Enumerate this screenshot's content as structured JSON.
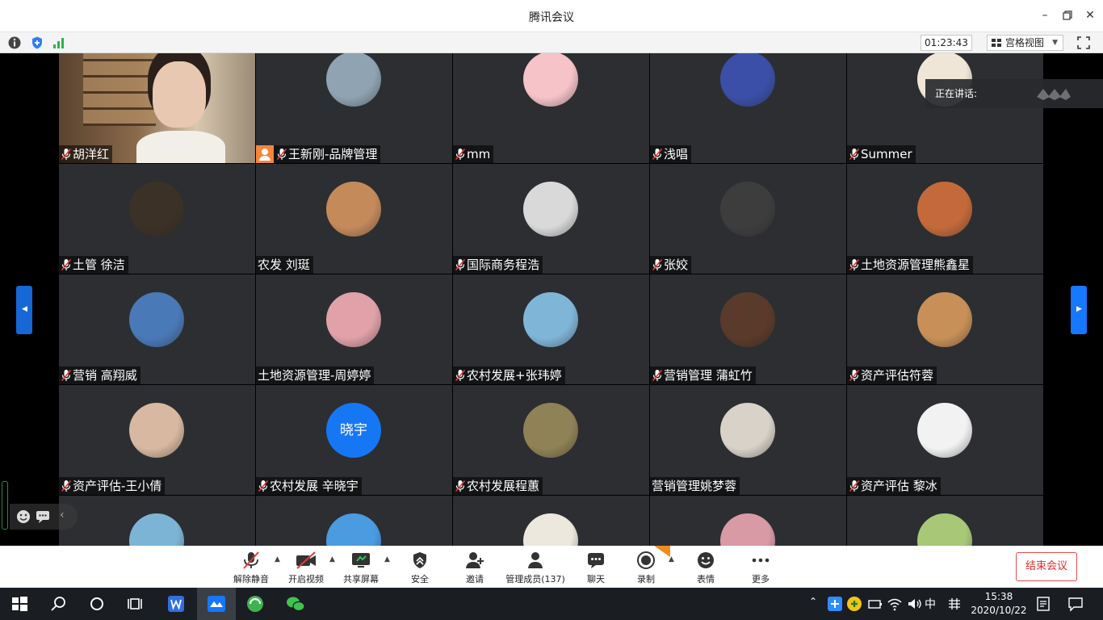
{
  "window": {
    "title": "腾讯会议"
  },
  "infobar": {
    "timer": "01:23:43",
    "view_mode": "宫格视图"
  },
  "speaking": {
    "label": "正在讲话:"
  },
  "participants": [
    {
      "name": "胡洋红",
      "mic": true,
      "avatar": "video",
      "avatar_color": "#7a5c3e"
    },
    {
      "name": "王新刚-品牌管理",
      "mic": true,
      "host": true,
      "avatar": "photo",
      "avatar_color": "#8fa3b2"
    },
    {
      "name": "mm",
      "mic": true,
      "avatar": "photo",
      "avatar_color": "#f6c3c8"
    },
    {
      "name": "浅唱",
      "mic": true,
      "avatar": "photo",
      "avatar_color": "#3b4fa8"
    },
    {
      "name": "Summer",
      "mic": true,
      "avatar": "photo",
      "avatar_color": "#efe6d8"
    },
    {
      "name": "土管 徐洁",
      "mic": true,
      "avatar": "photo",
      "avatar_color": "#3c3126"
    },
    {
      "name": "农发 刘珽",
      "mic": false,
      "avatar": "photo",
      "avatar_color": "#c58a5a"
    },
    {
      "name": "国际商务程浩",
      "mic": true,
      "avatar": "photo",
      "avatar_color": "#d9d9d9"
    },
    {
      "name": "张姣",
      "mic": true,
      "avatar": "photo",
      "avatar_color": "#3d3d3d"
    },
    {
      "name": "土地资源管理熊鑫星",
      "mic": true,
      "avatar": "photo",
      "avatar_color": "#c46a3a"
    },
    {
      "name": "营销 高翔威",
      "mic": true,
      "avatar": "photo",
      "avatar_color": "#4a79b8"
    },
    {
      "name": "土地资源管理-周婷婷",
      "mic": false,
      "avatar": "photo",
      "avatar_color": "#e0a1a8"
    },
    {
      "name": "农村发展+张玮婷",
      "mic": true,
      "avatar": "photo",
      "avatar_color": "#7fb6d8"
    },
    {
      "name": "营销管理 蒲虹竹",
      "mic": true,
      "avatar": "photo",
      "avatar_color": "#5a3a2a"
    },
    {
      "name": "资产评估符蓉",
      "mic": true,
      "avatar": "photo",
      "avatar_color": "#c89058"
    },
    {
      "name": "资产评估-王小倩",
      "mic": true,
      "avatar": "photo",
      "avatar_color": "#d8b8a0"
    },
    {
      "name": "农村发展 辛晓宇",
      "mic": true,
      "avatar": "text",
      "avatar_text": "晓宇",
      "avatar_color": "#1677f5"
    },
    {
      "name": "农村发展程蕙",
      "mic": true,
      "avatar": "photo",
      "avatar_color": "#8f8256"
    },
    {
      "name": "营销管理姚梦蓉",
      "mic": false,
      "avatar": "photo",
      "avatar_color": "#d8d2c8"
    },
    {
      "name": "资产评估 黎冰",
      "mic": true,
      "avatar": "photo",
      "avatar_color": "#f2f2f2"
    },
    {
      "name": "",
      "mic": false,
      "avatar": "photo",
      "avatar_color": "#7cb4d6"
    },
    {
      "name": "",
      "mic": false,
      "avatar": "photo",
      "avatar_color": "#4a9be0"
    },
    {
      "name": "",
      "mic": false,
      "avatar": "photo",
      "avatar_color": "#ece8de"
    },
    {
      "name": "",
      "mic": false,
      "avatar": "photo",
      "avatar_color": "#d89aa4"
    },
    {
      "name": "",
      "mic": false,
      "avatar": "photo",
      "avatar_color": "#a8c878"
    }
  ],
  "toolbar": {
    "unmute": "解除静音",
    "video": "开启视频",
    "share": "共享屏幕",
    "security": "安全",
    "invite": "邀请",
    "members": "管理成员(137)",
    "chat": "聊天",
    "record": "录制",
    "emoji": "表情",
    "more": "更多",
    "end": "结束会议"
  },
  "taskbar": {
    "ime": "中",
    "time": "15:38",
    "date": "2020/10/22"
  },
  "colors": {
    "accent": "#1677ff",
    "tile_bg": "#2c2e32",
    "end_red": "#e02c2c",
    "host_orange": "#f5873a"
  }
}
